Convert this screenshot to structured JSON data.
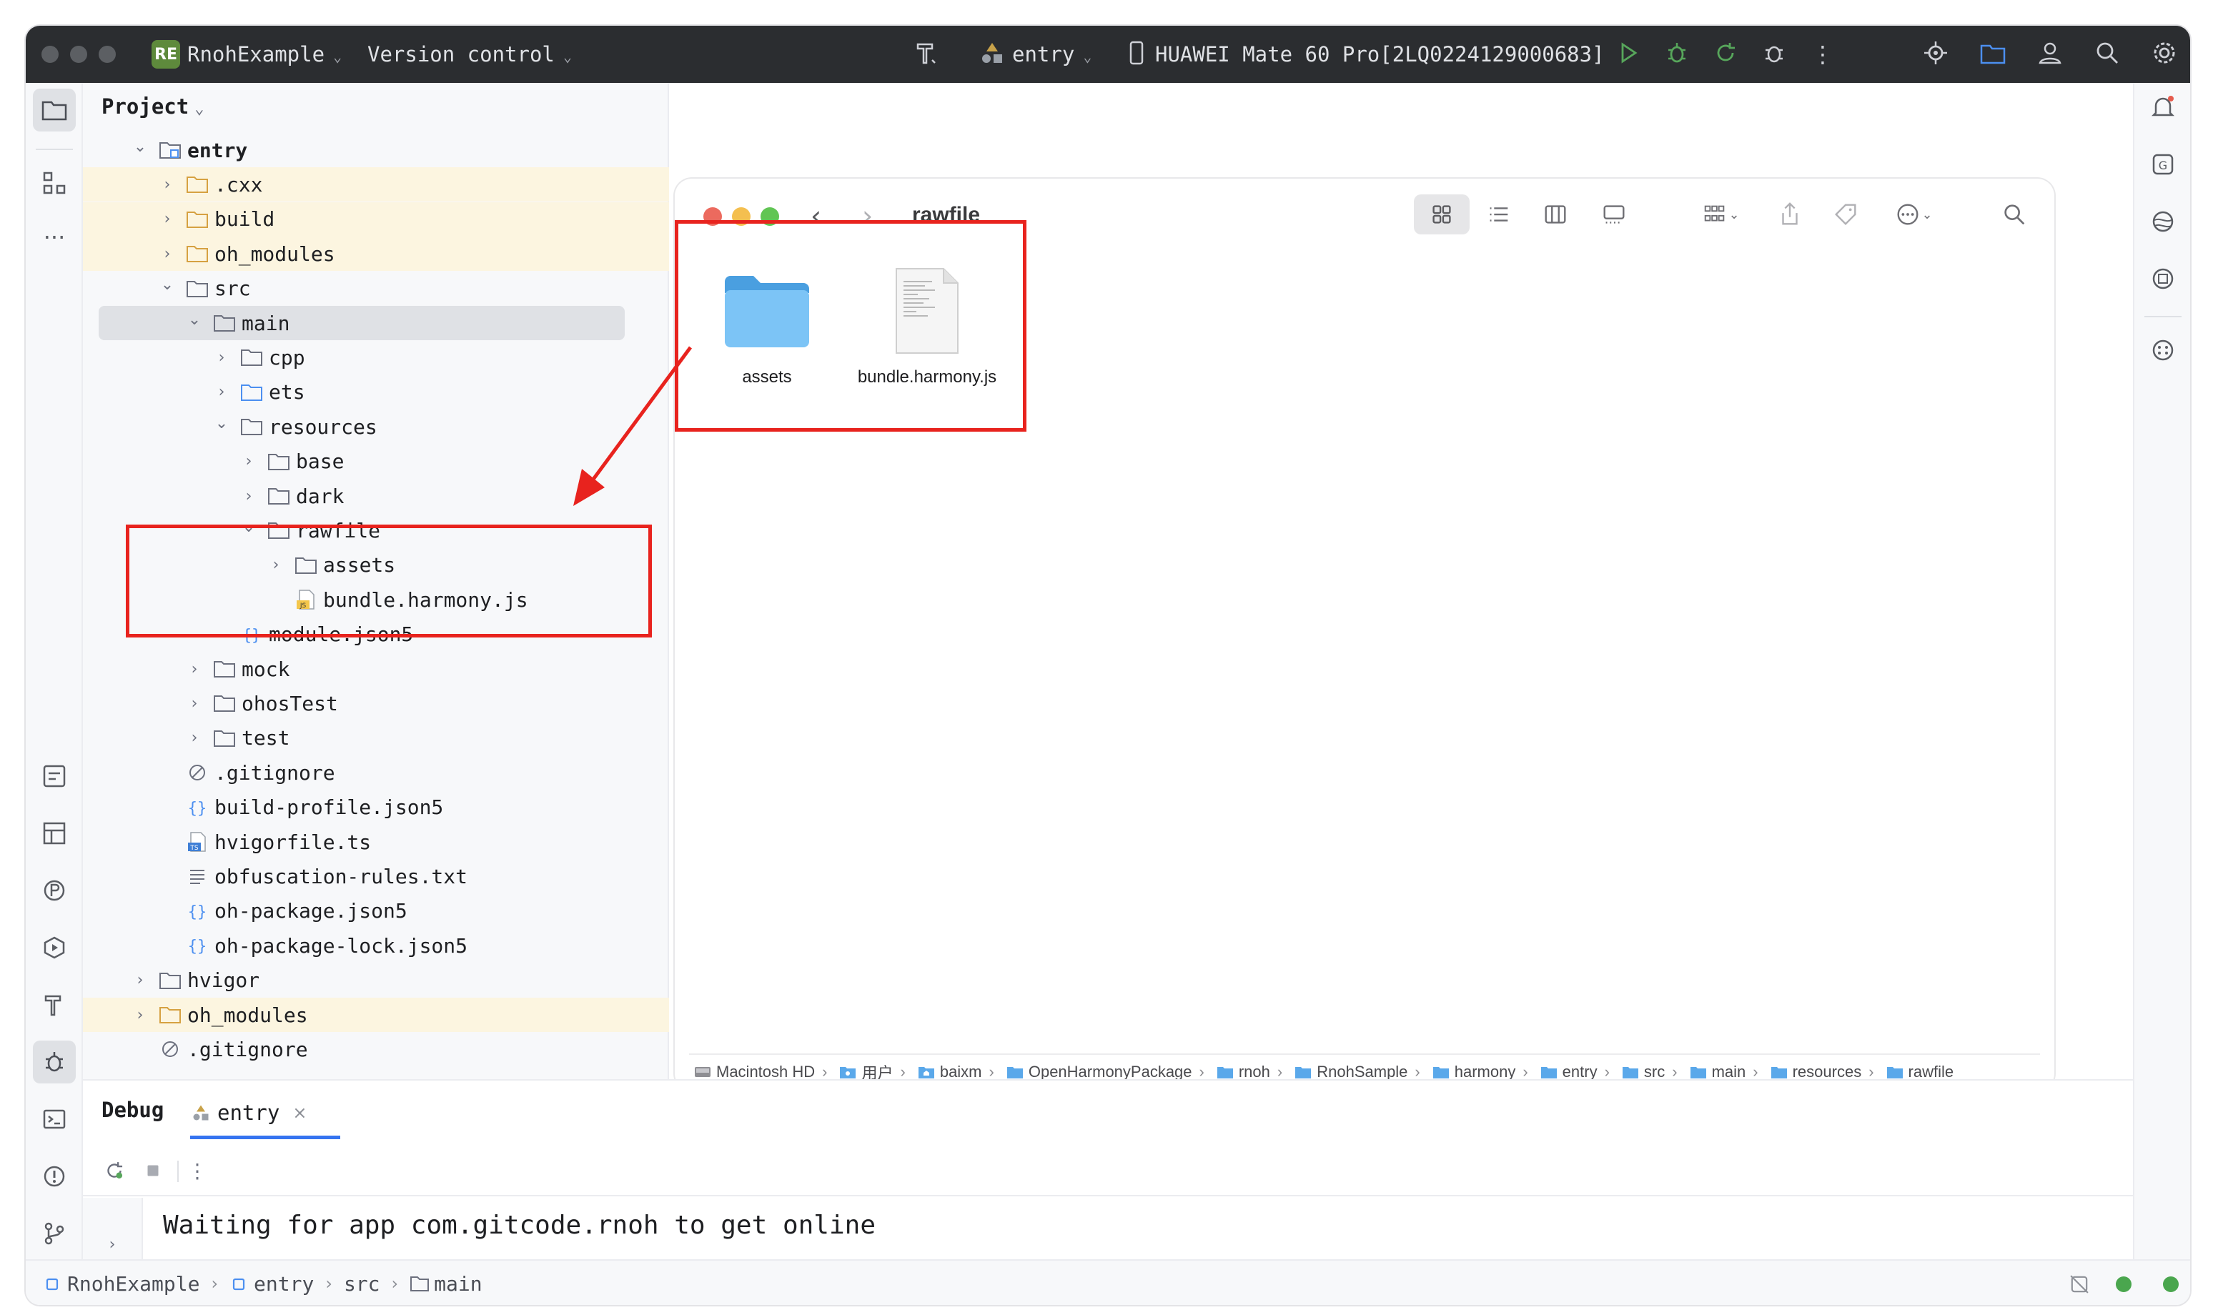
{
  "titlebar": {
    "project_badge": "RE",
    "project_name": "RnohExample",
    "vcs": "Version control",
    "run_config": "entry",
    "device": "HUAWEI Mate 60 Pro[2LQ0224129000683]"
  },
  "project_panel": {
    "title": "Project",
    "tree": [
      {
        "label": "entry",
        "depth": 0,
        "arrow": "open",
        "icon": "module",
        "hl": false,
        "bold": true
      },
      {
        "label": ".cxx",
        "depth": 1,
        "arrow": "closed",
        "icon": "folder-orange",
        "hl": true
      },
      {
        "label": "build",
        "depth": 1,
        "arrow": "closed",
        "icon": "folder-orange",
        "hl": true
      },
      {
        "label": "oh_modules",
        "depth": 1,
        "arrow": "closed",
        "icon": "folder-orange",
        "hl": true
      },
      {
        "label": "src",
        "depth": 1,
        "arrow": "open",
        "icon": "folder",
        "hl": false
      },
      {
        "label": "main",
        "depth": 2,
        "arrow": "open",
        "icon": "folder",
        "hl": false,
        "selected": true
      },
      {
        "label": "cpp",
        "depth": 3,
        "arrow": "closed",
        "icon": "folder",
        "hl": false
      },
      {
        "label": "ets",
        "depth": 3,
        "arrow": "closed",
        "icon": "folder-blue",
        "hl": false
      },
      {
        "label": "resources",
        "depth": 3,
        "arrow": "open",
        "icon": "folder",
        "hl": false
      },
      {
        "label": "base",
        "depth": 4,
        "arrow": "closed",
        "icon": "folder",
        "hl": false
      },
      {
        "label": "dark",
        "depth": 4,
        "arrow": "closed",
        "icon": "folder",
        "hl": false
      },
      {
        "label": "rawfile",
        "depth": 4,
        "arrow": "open",
        "icon": "folder",
        "hl": false
      },
      {
        "label": "assets",
        "depth": 5,
        "arrow": "closed",
        "icon": "folder",
        "hl": false
      },
      {
        "label": "bundle.harmony.js",
        "depth": 5,
        "arrow": "none",
        "icon": "js",
        "hl": false
      },
      {
        "label": "module.json5",
        "depth": 3,
        "arrow": "none",
        "icon": "json",
        "hl": false
      },
      {
        "label": "mock",
        "depth": 2,
        "arrow": "closed",
        "icon": "folder",
        "hl": false
      },
      {
        "label": "ohosTest",
        "depth": 2,
        "arrow": "closed",
        "icon": "folder",
        "hl": false
      },
      {
        "label": "test",
        "depth": 2,
        "arrow": "closed",
        "icon": "folder",
        "hl": false
      },
      {
        "label": ".gitignore",
        "depth": 1,
        "arrow": "none",
        "icon": "ignore",
        "hl": false
      },
      {
        "label": "build-profile.json5",
        "depth": 1,
        "arrow": "none",
        "icon": "json",
        "hl": false
      },
      {
        "label": "hvigorfile.ts",
        "depth": 1,
        "arrow": "none",
        "icon": "ts",
        "hl": false
      },
      {
        "label": "obfuscation-rules.txt",
        "depth": 1,
        "arrow": "none",
        "icon": "txt",
        "hl": false
      },
      {
        "label": "oh-package.json5",
        "depth": 1,
        "arrow": "none",
        "icon": "json",
        "hl": false
      },
      {
        "label": "oh-package-lock.json5",
        "depth": 1,
        "arrow": "none",
        "icon": "json",
        "hl": false
      },
      {
        "label": "hvigor",
        "depth": 0,
        "arrow": "closed",
        "icon": "folder",
        "hl": false
      },
      {
        "label": "oh_modules",
        "depth": 0,
        "arrow": "closed",
        "icon": "folder-orange",
        "hl": true
      },
      {
        "label": ".gitignore",
        "depth": 0,
        "arrow": "none",
        "icon": "ignore",
        "hl": false
      }
    ]
  },
  "finder": {
    "title": "rawfile",
    "items": [
      {
        "label": "assets",
        "kind": "folder"
      },
      {
        "label": "bundle.harmony.js",
        "kind": "document"
      }
    ],
    "path": [
      "Macintosh HD",
      "用户",
      "baixm",
      "OpenHarmonyPackage",
      "rnoh",
      "RnohSample",
      "harmony",
      "entry",
      "src",
      "main",
      "resources",
      "rawfile"
    ]
  },
  "debug": {
    "title": "Debug",
    "tab": "entry",
    "console_line": "Waiting for app com.gitcode.rnoh to get online"
  },
  "statusbar": {
    "breadcrumb": [
      "RnohExample",
      "entry",
      "src",
      "main"
    ]
  },
  "colors": {
    "titlebar_bg": "#2b2d30",
    "highlight_box": "#e8231e",
    "folder_blue": "#6cb5ee",
    "excluded_row": "#fcf5e0"
  }
}
